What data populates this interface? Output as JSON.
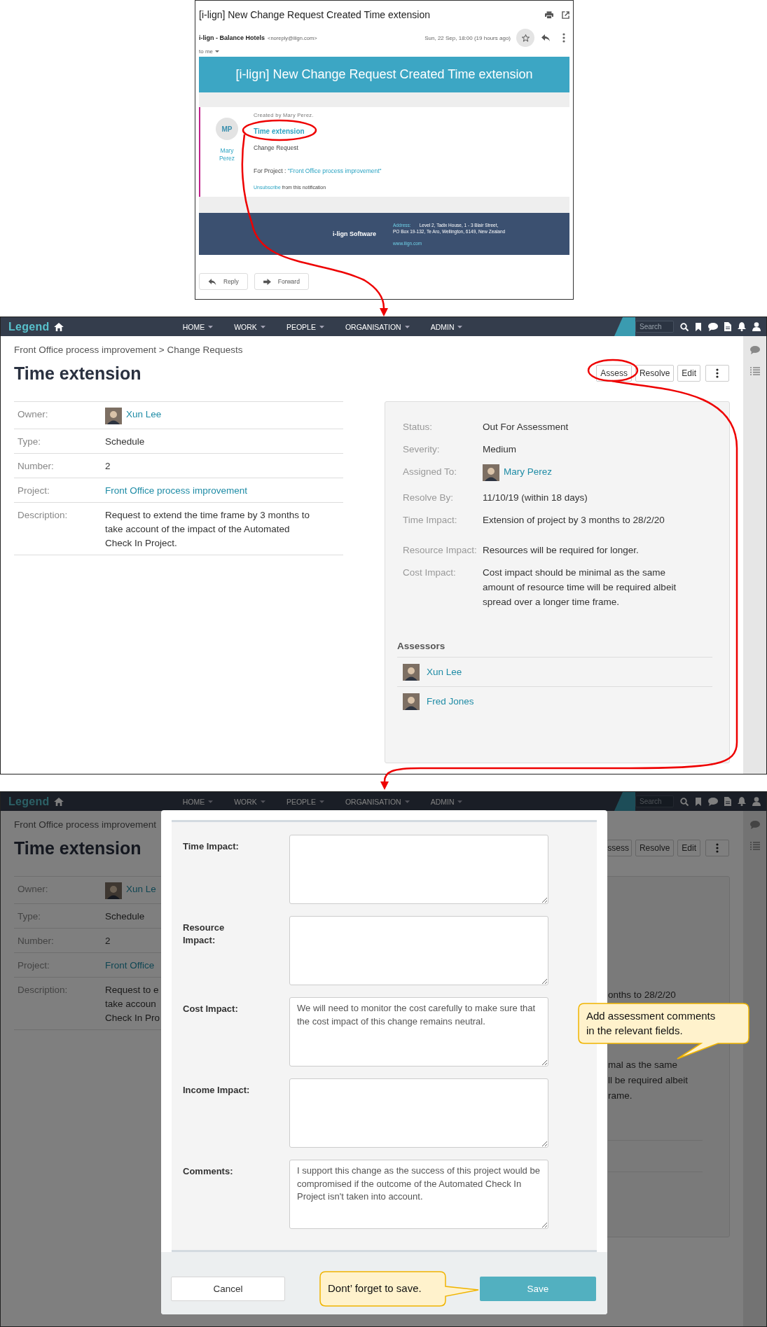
{
  "email": {
    "subject": "[i-lign] New Change Request Created Time extension",
    "sender_name": "i-lign - Balance Hotels",
    "sender_address": "<noreply@ilign.com>",
    "recipient": "to me",
    "date": "Sun, 22 Sep, 18:00 (19 hours ago)",
    "banner_title": "[i-lign] New Change Request Created Time extension",
    "avatar_initials": "MP",
    "author_name": "Mary Perez",
    "created_by": "Created by Mary Perez.",
    "item_title": "Time extension",
    "item_type": "Change Request",
    "project_prefix": "For Project : ",
    "project_link": "\"Front Office process improvement\"",
    "unsubscribe_link": "Unsubscribe",
    "unsubscribe_rest": " from this notification",
    "footer_company": "i-lign Software",
    "address_label": "Address:",
    "address_lines": [
      "Level 2, Tadix House, 1 - 3 Blair Street,",
      "PO Box 19-132, Te Aro, Wellington, 6149, New Zealand"
    ],
    "website": "www.ilign.com",
    "buttons": [
      "Reply",
      "Forward"
    ]
  },
  "record_page": {
    "nav": {
      "logo": "Legend",
      "items": [
        "HOME",
        "WORK",
        "PEOPLE",
        "ORGANISATION",
        "ADMIN"
      ],
      "search_placeholder": "Search"
    },
    "breadcrumb": "Front Office process improvement > Change Requests",
    "title": "Time extension",
    "actions": [
      "Assess",
      "Resolve",
      "Edit"
    ],
    "details": [
      {
        "label": "Owner:",
        "value": "Xun Lee",
        "kind": "person"
      },
      {
        "label": "Type:",
        "value": "Schedule",
        "kind": "text"
      },
      {
        "label": "Number:",
        "value": "2",
        "kind": "text"
      },
      {
        "label": "Project:",
        "value": "Front Office process improvement",
        "kind": "link"
      },
      {
        "label": "Description:",
        "value": "Request to extend the time frame by 3 months to take account of the impact of the Automated Check In Project.",
        "kind": "text"
      }
    ],
    "summary": [
      {
        "label": "Status:",
        "value": "Out For Assessment",
        "kind": "text"
      },
      {
        "label": "Severity:",
        "value": "Medium",
        "kind": "text"
      },
      {
        "label": "Assigned To:",
        "value": "Mary Perez",
        "kind": "person"
      },
      {
        "label": "Resolve By:",
        "value": "11/10/19 (within 18 days)",
        "kind": "text"
      },
      {
        "label": "Time Impact:",
        "value": "Extension of project by 3 months to 28/2/20",
        "kind": "text"
      },
      {
        "label": "Resource Impact:",
        "value": "Resources will be required for longer.",
        "kind": "text"
      },
      {
        "label": "Cost Impact:",
        "value": "Cost impact should be minimal as the same amount of resource time will be required albeit spread over a longer time frame.",
        "kind": "text"
      }
    ],
    "assessors_heading": "Assessors",
    "assessors": [
      "Xun Lee",
      "Fred Jones"
    ]
  },
  "assess_screen": {
    "page": {
      "nav": {
        "logo": "Legend",
        "items": [
          "HOME",
          "WORK",
          "PEOPLE",
          "ORGANISATION",
          "ADMIN"
        ],
        "search_placeholder": "Search"
      },
      "breadcrumb": "Front Office process improvement",
      "title": "Time extension",
      "actions": [
        "ssess",
        "Resolve",
        "Edit"
      ],
      "details": [
        {
          "label": "Owner:",
          "lines": [
            "Xun Le"
          ],
          "kind": "person"
        },
        {
          "label": "Type:",
          "lines": [
            "Schedule"
          ],
          "kind": "text"
        },
        {
          "label": "Number:",
          "lines": [
            "2"
          ],
          "kind": "text"
        },
        {
          "label": "Project:",
          "lines": [
            "Front Office"
          ],
          "kind": "link"
        },
        {
          "label": "Description:",
          "lines": [
            "Request to e",
            "take accoun",
            "Check In Pro"
          ],
          "kind": "text"
        }
      ],
      "summary_fragments": [
        "onths to 28/2/20",
        "mal as the same",
        "ll be required albeit",
        "rame."
      ]
    },
    "dialog": {
      "fields": [
        {
          "label": "Time Impact:"
        },
        {
          "label": "Resource Impact:"
        },
        {
          "label": "Cost Impact:",
          "value": "We will need to monitor the cost carefully to make sure that the cost impact of this change remains neutral."
        },
        {
          "label": "Income Impact:"
        },
        {
          "label": "Comments:",
          "value": "I support this change as the success of this project would be compromised if the outcome of the Automated Check In Project isn't taken into account."
        }
      ],
      "cancel": "Cancel",
      "save": "Save"
    },
    "callouts": [
      {
        "text": "Add assessment comments in the relevant fields."
      },
      {
        "text": "Dont’ forget to save."
      }
    ]
  }
}
